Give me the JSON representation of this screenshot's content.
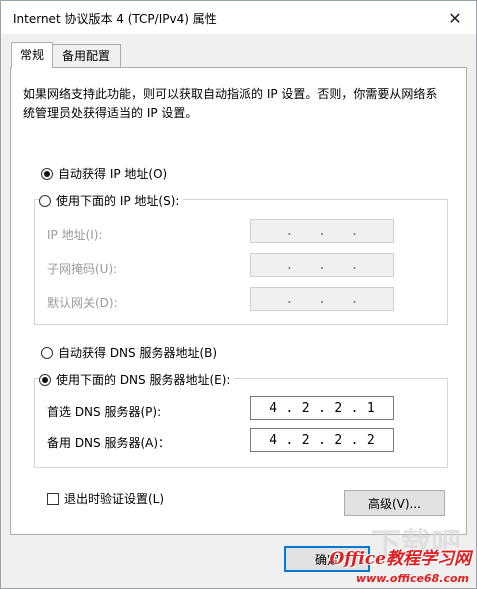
{
  "window": {
    "title": "Internet 协议版本 4 (TCP/IPv4) 属性",
    "close_symbol": "✕"
  },
  "tabs": [
    {
      "label": "常规",
      "active": true
    },
    {
      "label": "备用配置",
      "active": false
    }
  ],
  "description": "如果网络支持此功能，则可以获取自动指派的 IP 设置。否则，你需要从网络系统管理员处获得适当的 IP 设置。",
  "ip_section": {
    "auto_label": "自动获得 IP 地址(O)",
    "auto_checked": true,
    "manual_label": "使用下面的 IP 地址(S):",
    "manual_checked": false,
    "fields": [
      {
        "label": "IP 地址(I):",
        "value": [
          " ",
          " ",
          " ",
          " "
        ]
      },
      {
        "label": "子网掩码(U):",
        "value": [
          " ",
          " ",
          " ",
          " "
        ]
      },
      {
        "label": "默认网关(D):",
        "value": [
          " ",
          " ",
          " ",
          " "
        ]
      }
    ]
  },
  "dns_section": {
    "auto_label": "自动获得 DNS 服务器地址(B)",
    "auto_checked": false,
    "manual_label": "使用下面的 DNS 服务器地址(E):",
    "manual_checked": true,
    "preferred": {
      "label": "首选 DNS 服务器(P):",
      "value": [
        "4",
        "2",
        "2",
        "1"
      ]
    },
    "alternate": {
      "label": "备用 DNS 服务器(A)：",
      "value": [
        "4",
        "2",
        "2",
        "2"
      ]
    }
  },
  "validate": {
    "label": "退出时验证设置(L)",
    "checked": false
  },
  "buttons": {
    "advanced": "高级(V)...",
    "ok": "确定"
  },
  "watermark": {
    "main": "Office教程学习网",
    "url": "www.office68.com",
    "bg": "下载吧"
  }
}
